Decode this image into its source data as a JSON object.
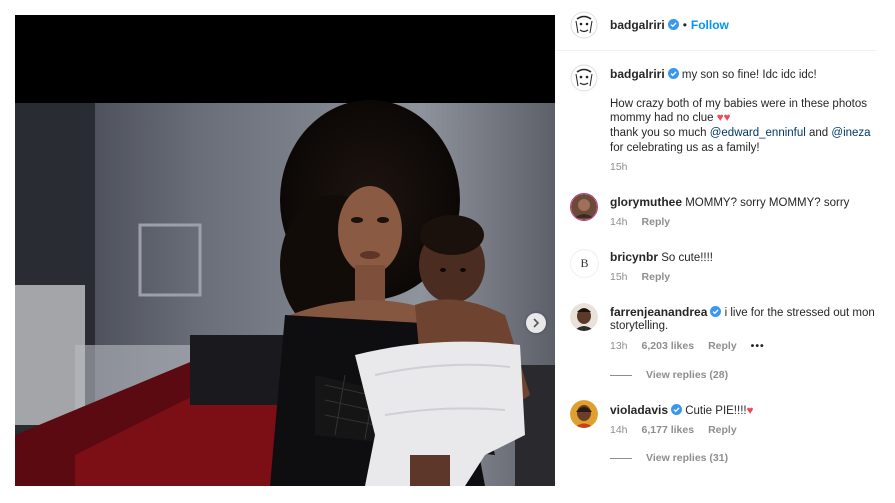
{
  "post": {
    "author": "badgalriri",
    "follow_label": "Follow",
    "separator": "•",
    "caption": {
      "line1": "my son so fine! Idc idc idc!",
      "line2": "How crazy both of my babies were in these photos",
      "line3": "mommy had no clue",
      "line3_emoji": "♥♥",
      "line4_prefix": "thank you so much ",
      "mention1": "@edward_enninful",
      "line4_mid": " and ",
      "mention2": "@ineza",
      "line5": "for celebrating us as a family!",
      "time": "15h"
    }
  },
  "comments": [
    {
      "username": "glorymuthee",
      "verified": false,
      "text": "MOMMY? sorry MOMMY? sorry",
      "time": "14h",
      "reply_label": "Reply"
    },
    {
      "username": "bricynbr",
      "verified": false,
      "avatar_letter": "B",
      "text": "So cute!!!!",
      "time": "15h",
      "reply_label": "Reply"
    },
    {
      "username": "farrenjeanandrea",
      "verified": true,
      "text_line1": "i live for the stressed out mon",
      "text_line2": "storytelling.",
      "time": "13h",
      "likes": "6,203 likes",
      "reply_label": "Reply",
      "more": "•••",
      "view_replies": "View replies (28)"
    },
    {
      "username": "violadavis",
      "verified": true,
      "text": "Cutie PIE!!!!",
      "emoji": "♥",
      "time": "14h",
      "likes": "6,177 likes",
      "reply_label": "Reply",
      "view_replies": "View replies (31)"
    }
  ],
  "colors": {
    "link_blue": "#0095f6",
    "mention": "#00376b",
    "meta_gray": "#8e8e8e",
    "heart_red": "#ed4956"
  },
  "icons": {
    "verified": "verified-badge-icon",
    "next": "chevron-right-icon",
    "heart": "heart-emoji"
  }
}
